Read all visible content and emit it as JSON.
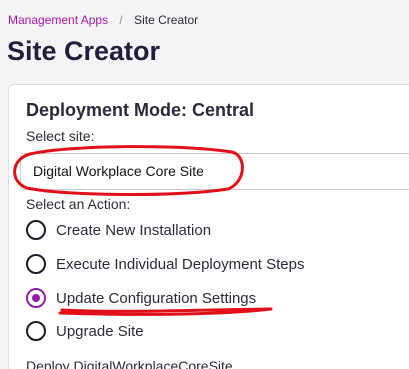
{
  "breadcrumb": {
    "parent": "Management Apps",
    "separator": "/",
    "current": "Site Creator"
  },
  "page_title": "Site Creator",
  "panel": {
    "mode_heading": "Deployment Mode: Central",
    "select_site_label": "Select site:",
    "selected_site": "Digital Workplace Core Site",
    "action_label": "Select an Action:",
    "actions": [
      {
        "label": "Create New Installation",
        "checked": false
      },
      {
        "label": "Execute Individual Deployment Steps",
        "checked": false
      },
      {
        "label": "Update Configuration Settings",
        "checked": true
      },
      {
        "label": "Upgrade Site",
        "checked": false
      }
    ],
    "deploy_text": "Deploy DigitalWorkplaceCoreSite"
  },
  "colors": {
    "accent": "#8f1fa8",
    "breadcrumb_link": "#a319a3",
    "annotation": "#e0101a"
  }
}
